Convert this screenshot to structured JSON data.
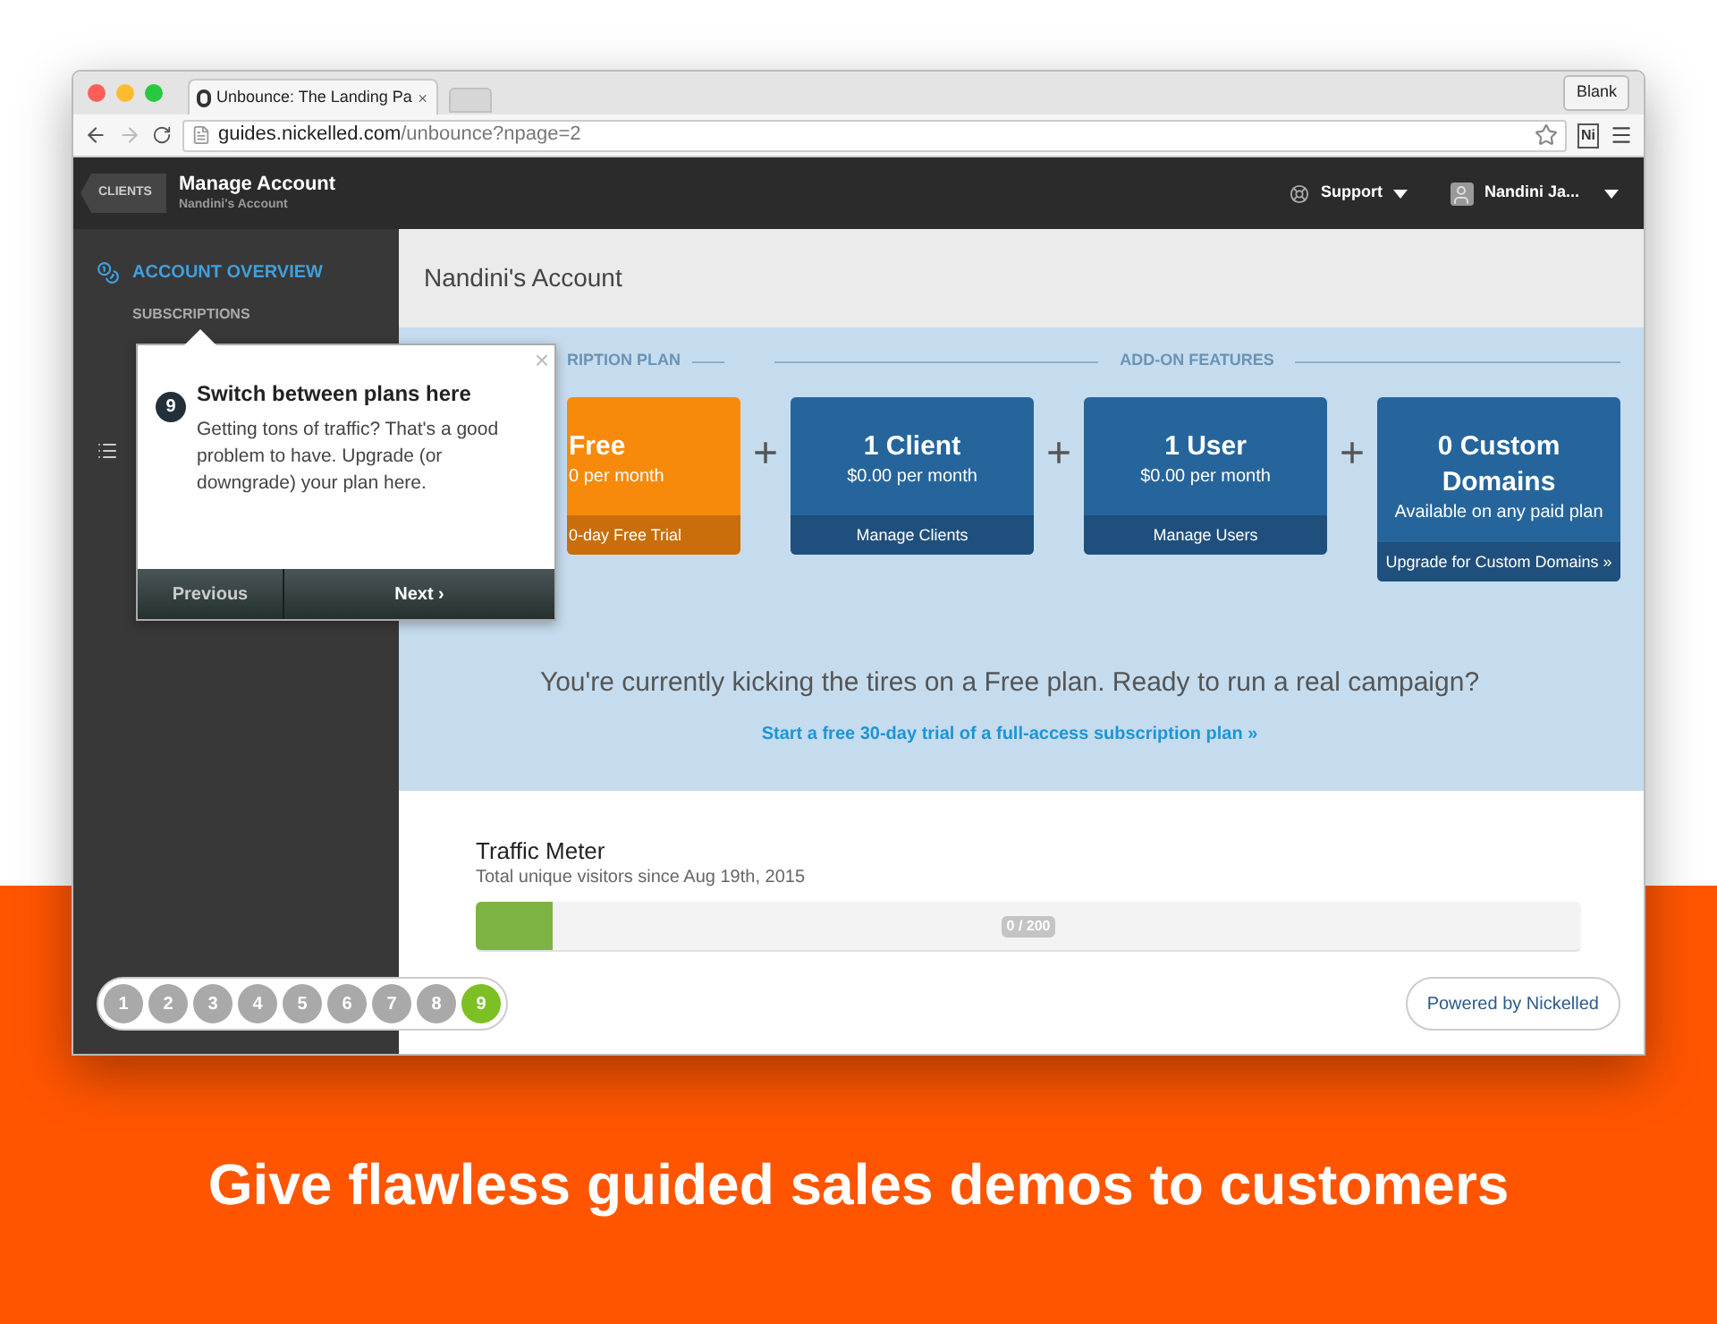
{
  "browser": {
    "tab_title": "Unbounce: The Landing Pa",
    "blank_button": "Blank",
    "url_host": "guides.nickelled.com",
    "url_path": "/unbounce?npage=2",
    "extension": "Ni"
  },
  "header": {
    "back_button": "CLIENTS",
    "title": "Manage Account",
    "subtitle": "Nandini's Account",
    "support": "Support",
    "user": "Nandini Ja..."
  },
  "sidebar": {
    "items": [
      {
        "label": "ACCOUNT OVERVIEW",
        "selected": true
      },
      {
        "label": "SUBSCRIPTIONS",
        "selected": false
      }
    ]
  },
  "page_title": "Nandini's Account",
  "sections": [
    "RIPTION PLAN",
    "ADD-ON FEATURES"
  ],
  "cards": [
    {
      "kind": "plan",
      "title": "Free",
      "price": "0 per month",
      "action": "0-day Free Trial"
    },
    {
      "kind": "addon",
      "joiner": "+",
      "title": "1 Client",
      "price": "$0.00 per month",
      "action": "Manage Clients"
    },
    {
      "kind": "addon",
      "joiner": "+",
      "title": "1 User",
      "price": "$0.00 per month",
      "action": "Manage Users"
    },
    {
      "kind": "addon",
      "joiner": "+",
      "title": "0 Custom Domains",
      "price": "Available on any paid plan",
      "action": "Upgrade for Custom Domains »"
    }
  ],
  "promo": {
    "text": "You're currently kicking the tires on a Free plan. Ready to run a real campaign?",
    "link": "Start a free 30-day trial of a full-access subscription plan »"
  },
  "traffic_meter": {
    "title": "Traffic Meter",
    "subtitle": "Total unique visitors since Aug 19th, 2015",
    "level": 0.07,
    "reading": "0 / 200"
  },
  "tour": {
    "step": "9",
    "title": "Switch between plans here",
    "body": "Getting tons of traffic? That's a good problem to have. Upgrade (or downgrade) your plan here.",
    "close": "×",
    "previous": "Previous",
    "next": "Next ›",
    "steps": [
      {
        "label": "1",
        "selected": false
      },
      {
        "label": "2",
        "selected": false
      },
      {
        "label": "3",
        "selected": false
      },
      {
        "label": "4",
        "selected": false
      },
      {
        "label": "5",
        "selected": false
      },
      {
        "label": "6",
        "selected": false
      },
      {
        "label": "7",
        "selected": false
      },
      {
        "label": "8",
        "selected": false
      },
      {
        "label": "9",
        "selected": true
      }
    ]
  },
  "powered_by": "Powered by Nickelled",
  "caption": "Give flawless guided sales demos to customers"
}
